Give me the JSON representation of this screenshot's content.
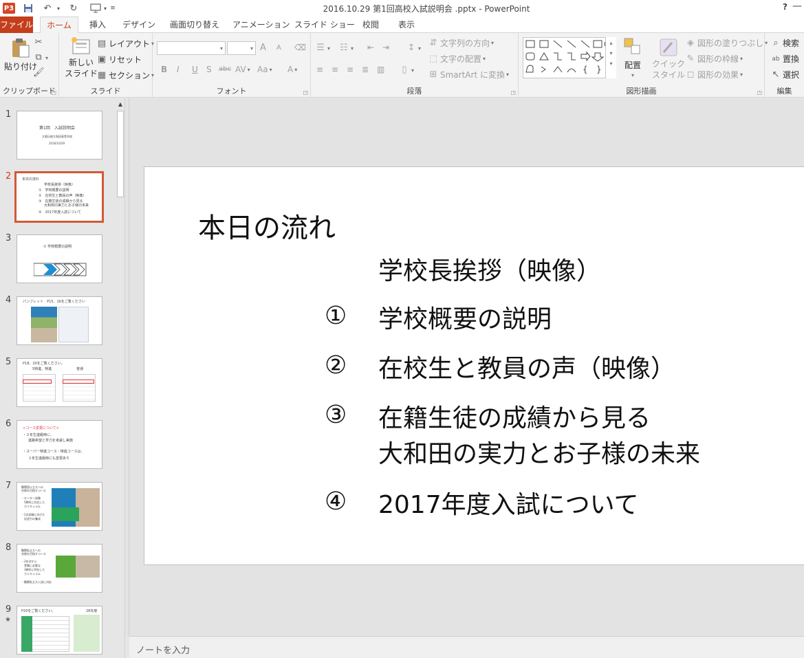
{
  "window": {
    "title": "2016.10.29 第1回高校入試説明会 .pptx - PowerPoint",
    "app_icon": "P3",
    "help": "?",
    "minimize": "—"
  },
  "tabs": [
    "ファイル",
    "ホーム",
    "挿入",
    "デザイン",
    "画面切り替え",
    "アニメーション",
    "スライド ショー",
    "校閲",
    "表示"
  ],
  "active_tab": "ホーム",
  "ribbon": {
    "clipboard": {
      "label": "クリップボード",
      "paste": "貼り付け"
    },
    "slides": {
      "label": "スライド",
      "new_slide_1": "新しい",
      "new_slide_2": "スライド",
      "layout": "レイアウト",
      "reset": "リセット",
      "section": "セクション"
    },
    "font": {
      "label": "フォント",
      "bold": "B",
      "italic": "I",
      "underline": "U",
      "shadow": "S",
      "strike": "abc",
      "spacing": "AV",
      "case": "Aa",
      "color": "A",
      "grow": "A",
      "shrink": "A"
    },
    "paragraph": {
      "label": "段落",
      "text_direction": "文字列の方向",
      "align_text": "文字の配置",
      "smartart": "SmartArt に変換"
    },
    "drawing": {
      "label": "図形描画",
      "arrange": "配置",
      "quick_style_1": "クイック",
      "quick_style_2": "スタイル",
      "fill": "図形の塗りつぶし",
      "outline": "図形の枠線",
      "effects": "図形の効果"
    },
    "editing": {
      "label": "編集",
      "find": "検索",
      "replace": "置換",
      "select": "選択"
    }
  },
  "thumbnails": [
    {
      "num": "1",
      "lines": [
        "第1回　入試説明会",
        "大阪伝統大和田高等学校",
        "2016/10/29"
      ]
    },
    {
      "num": "2",
      "lines": [
        "本日の流れ",
        "学校長挨拶（映像）",
        "①　学校概要の説明",
        "②　在校生と教員の声（映像）",
        "③　在籍生徒の成績から見る",
        "大和田の実力とお子様の未来",
        "④　2017年度入試について"
      ]
    },
    {
      "num": "3",
      "lines": [
        "①  学校概要の説明"
      ]
    },
    {
      "num": "4",
      "lines": [
        "パンフレット　P15、16をご覧ください"
      ]
    },
    {
      "num": "5",
      "lines": [
        "P18、20をご覧ください。",
        "S特進、特進",
        "普通"
      ]
    },
    {
      "num": "6",
      "lines": [
        "<コース変更について>",
        "・２年生進級時に、",
        "進路希望と学力を考慮し実施",
        "・スーパー特進コース・特進コースは、",
        "３年生進級時にも変更あり"
      ]
    },
    {
      "num": "7",
      "lines": [
        "難関国公立大への",
        "合格を目指すコース",
        "・センター試験",
        "5教科に対応した",
        "カリキュラム",
        "・2次試験に向けた",
        "記述力の養成"
      ]
    },
    {
      "num": "8",
      "lines": [
        "難関私立大への",
        "合格を目指すコース",
        "・2年次から",
        "受験に必要な",
        "3教科に特化した",
        "カリキュラム",
        "・難関私立大入試に対応"
      ]
    },
    {
      "num": "9",
      "star": "★",
      "lines": [
        "P20をご覧ください。",
        "28年度"
      ]
    }
  ],
  "slide": {
    "title": "本日の流れ",
    "items": [
      {
        "num": "",
        "text": "学校長挨拶（映像）"
      },
      {
        "num": "①",
        "text": "学校概要の説明"
      },
      {
        "num": "②",
        "text": "在校生と教員の声（映像）"
      },
      {
        "num": "③",
        "text": "在籍生徒の成績から見る",
        "text2": "大和田の実力とお子様の未来"
      },
      {
        "num": "④",
        "text": "2017年度入試について"
      }
    ]
  },
  "notes": {
    "placeholder": "ノートを入力"
  },
  "colors": {
    "accent": "#c43e1c",
    "selection": "#d05a35",
    "file_tab": "#c43e1c"
  }
}
